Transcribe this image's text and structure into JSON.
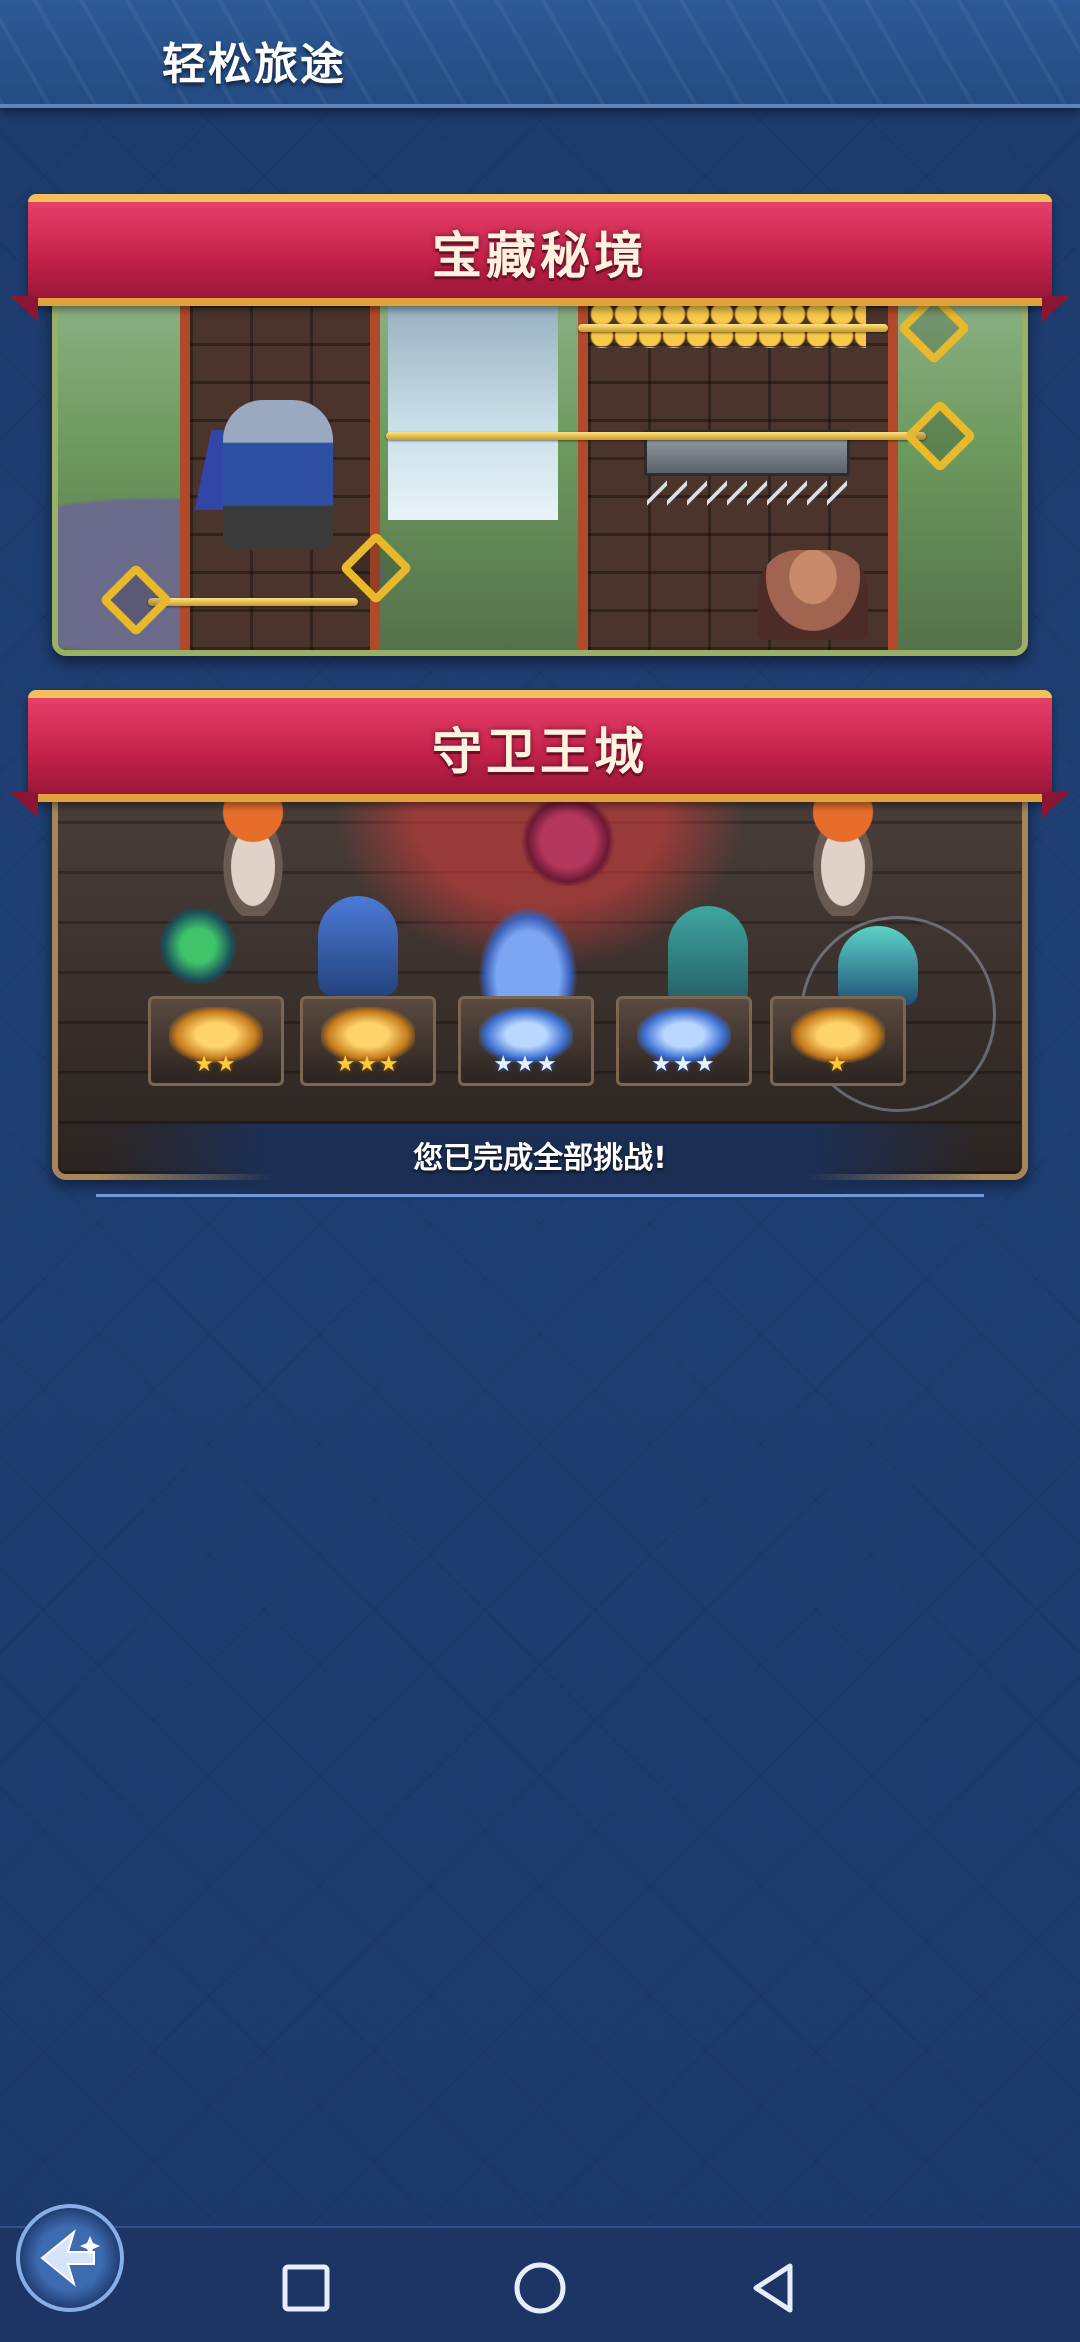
{
  "header": {
    "title": "轻松旅途"
  },
  "cards": [
    {
      "banner_title": "宝藏秘境"
    },
    {
      "banner_title": "守卫王城"
    }
  ],
  "battle_slots": [
    {
      "stars": "★★",
      "tier": "gold"
    },
    {
      "stars": "★★★",
      "tier": "gold"
    },
    {
      "stars": "★★★",
      "tier": "blue"
    },
    {
      "stars": "★★★",
      "tier": "blue"
    },
    {
      "stars": "★",
      "tier": "gold"
    }
  ],
  "status": {
    "caption": "您已完成全部挑战!"
  },
  "colors": {
    "banner": "#c7234c",
    "background": "#1f3f74",
    "accent_gold": "#f1c25b"
  },
  "icons": {
    "back_button": "back-arrow-sparkle-icon",
    "nav": [
      "square-recents-icon",
      "circle-home-icon",
      "triangle-back-icon"
    ]
  }
}
